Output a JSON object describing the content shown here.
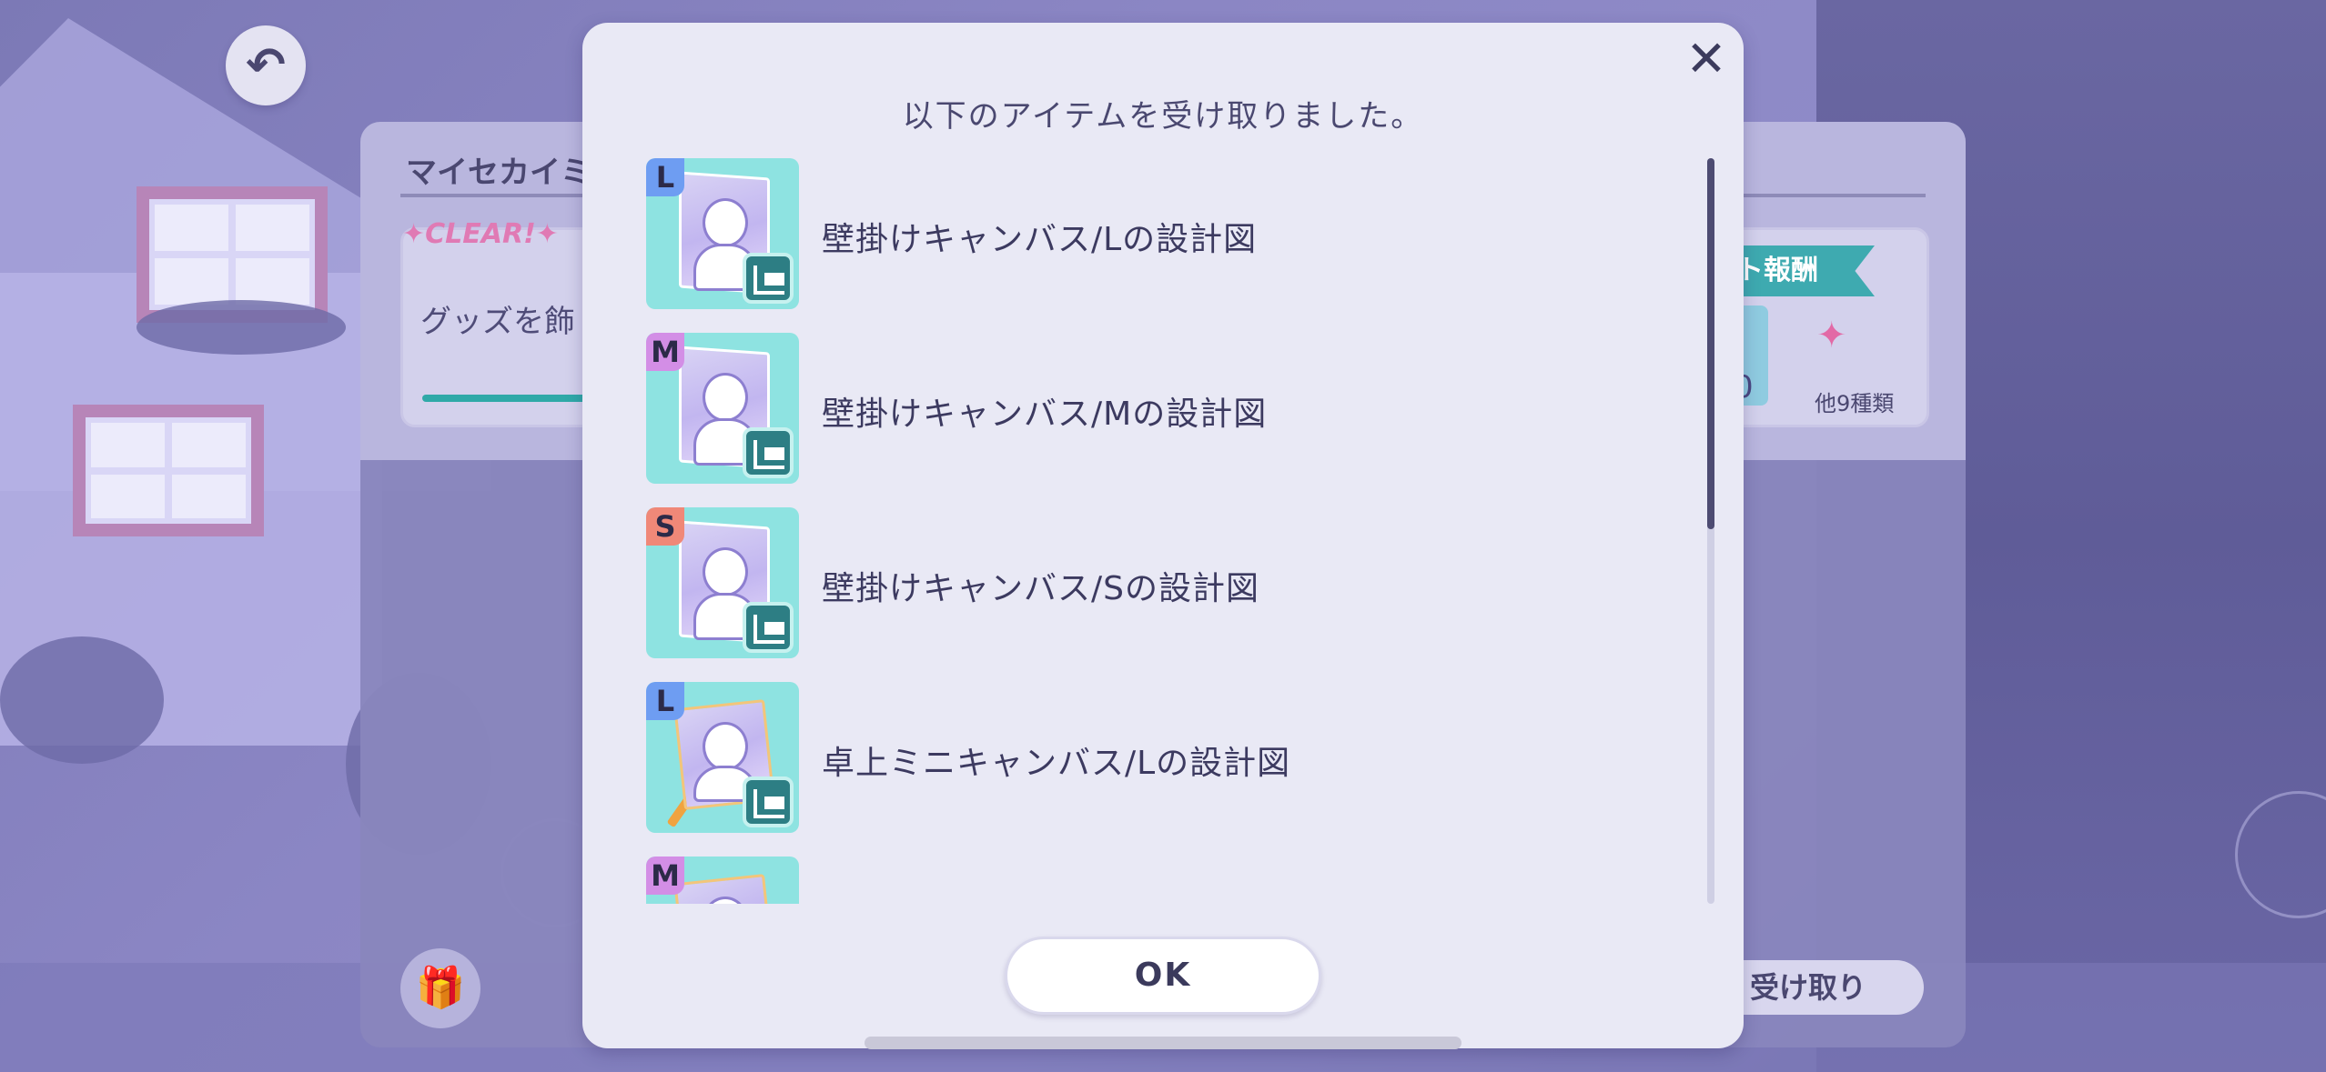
{
  "screen": {
    "back_button_icon": "undo-arrow-icon"
  },
  "background_panel": {
    "title": "マイセカイミ",
    "clear_badge": "✦CLEAR!✦",
    "mission_text": "グッズを飾",
    "reward_ribbon": "ト報酬",
    "reward_count": "0",
    "others_label": "他9種類",
    "claim_button": "受け取り",
    "gift_icon": "gift-icon"
  },
  "modal": {
    "title": "以下のアイテムを受け取りました。",
    "close_icon": "close-icon",
    "ok_label": "OK",
    "items": [
      {
        "size": "L",
        "name": "壁掛けキャンバス/Lの設計図",
        "kind": "wall-canvas",
        "badge_color": "#6e9df2"
      },
      {
        "size": "M",
        "name": "壁掛けキャンバス/Mの設計図",
        "kind": "wall-canvas",
        "badge_color": "#d38ee6"
      },
      {
        "size": "S",
        "name": "壁掛けキャンバス/Sの設計図",
        "kind": "wall-canvas",
        "badge_color": "#f08878"
      },
      {
        "size": "L",
        "name": "卓上ミニキャンバス/Lの設計図",
        "kind": "easel-canvas",
        "badge_color": "#6e9df2"
      },
      {
        "size": "M",
        "name": "",
        "kind": "easel-canvas",
        "badge_color": "#d38ee6"
      }
    ],
    "scroll_position": 0.0
  },
  "colors": {
    "modal_bg": "#e9e9f5",
    "thumb_bg": "#8ee3e1",
    "text_dark": "#3c3a60",
    "accent_teal": "#2fa9a8"
  }
}
